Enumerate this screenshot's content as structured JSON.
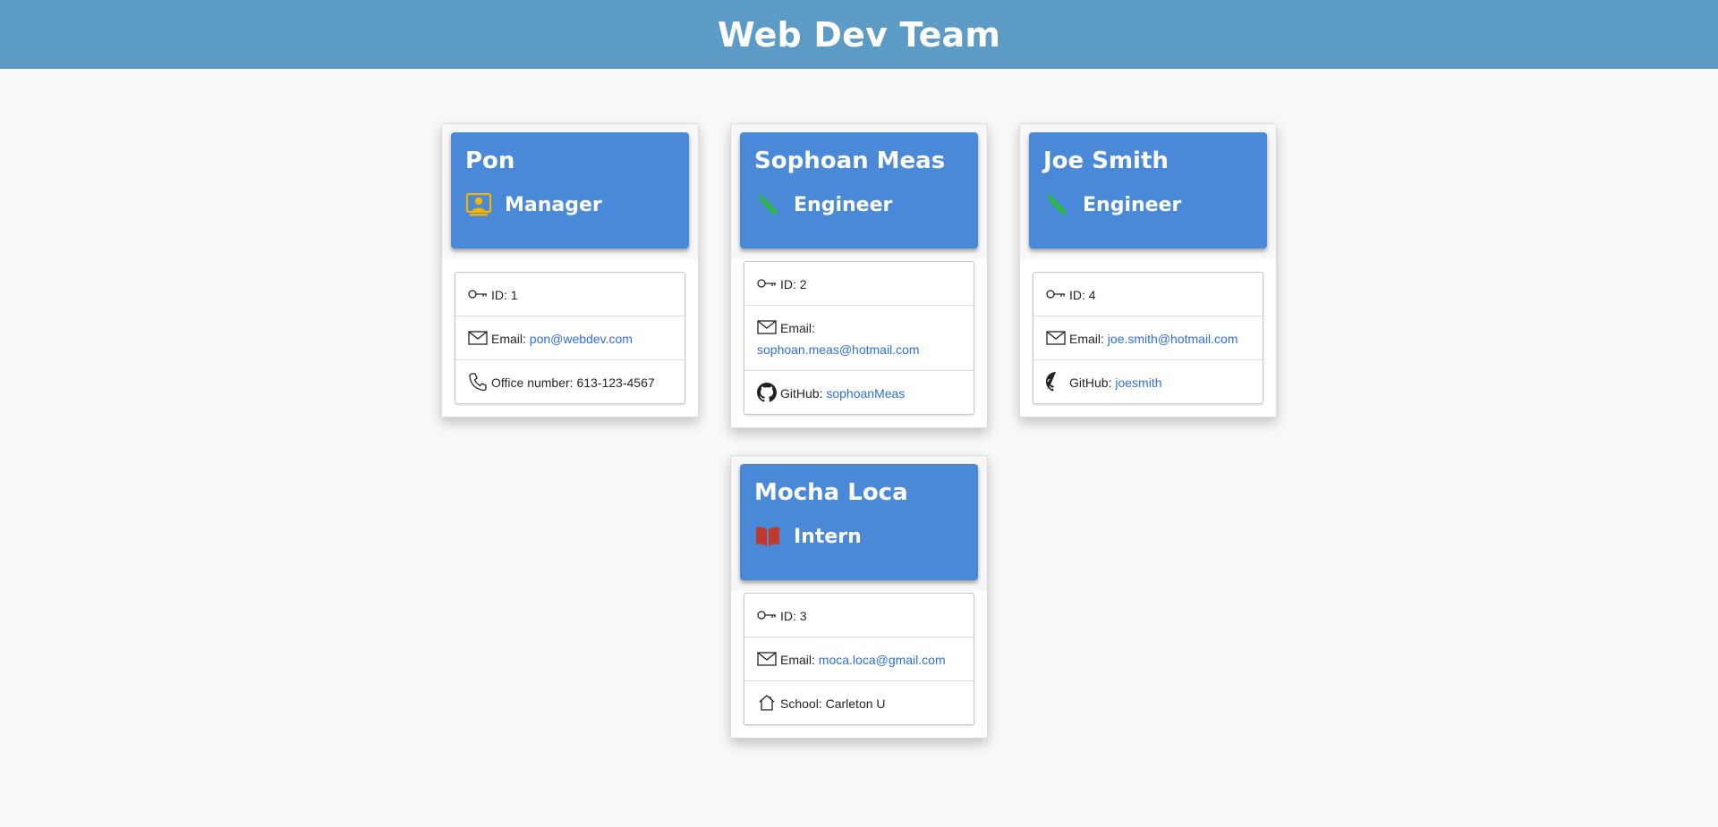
{
  "page": {
    "title": "Web Dev Team"
  },
  "colors": {
    "header_bar": "#5b9bc6",
    "card_header": "#4a89d8",
    "link": "#2f6fd6",
    "manager_icon": "#f4b400",
    "engineer_icon": "#2eb84b",
    "intern_icon": "#c0392b"
  },
  "employees": [
    {
      "name": "Pon",
      "role": "Manager",
      "role_icon": "manager-badge-icon",
      "id_label": "ID: ",
      "id": "1",
      "email_label": "Email: ",
      "email": "pon@webdev.com",
      "extra_label": "Office number: ",
      "extra_value": "613-123-4567",
      "extra_icon": "phone-icon"
    },
    {
      "name": "Sophoan Meas",
      "role": "Engineer",
      "role_icon": "wrench-icon",
      "id_label": "ID: ",
      "id": "2",
      "email_label": "Email: ",
      "email": "sophoan.meas@hotmail.com",
      "extra_label": "GitHub: ",
      "extra_value": "sophoanMeas",
      "extra_icon": "github-icon"
    },
    {
      "name": "Joe Smith",
      "role": "Engineer",
      "role_icon": "wrench-icon",
      "id_label": "ID: ",
      "id": "4",
      "email_label": "Email: ",
      "email": "joe.smith@hotmail.com",
      "extra_label": "GitHub: ",
      "extra_value": "joesmith",
      "extra_icon": "github-icon"
    },
    {
      "name": "Mocha Loca",
      "role": "Intern",
      "role_icon": "book-icon",
      "id_label": "ID: ",
      "id": "3",
      "email_label": "Email: ",
      "email": "moca.loca@gmail.com",
      "extra_label": "School: ",
      "extra_value": "Carleton U",
      "extra_icon": "house-icon"
    }
  ]
}
